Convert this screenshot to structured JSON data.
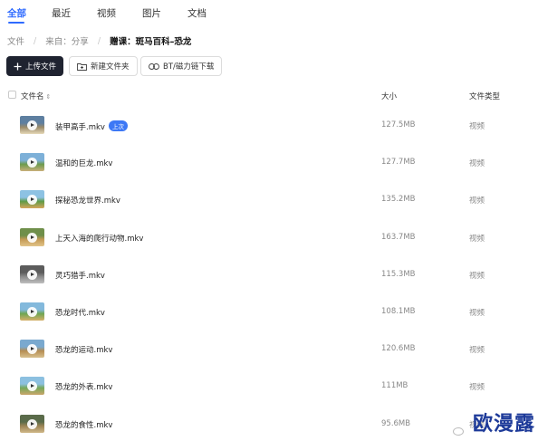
{
  "tabs": [
    {
      "label": "全部"
    },
    {
      "label": "最近"
    },
    {
      "label": "视频"
    },
    {
      "label": "图片"
    },
    {
      "label": "文档"
    }
  ],
  "breadcrumb": {
    "root": "文件",
    "from": "来自：分享",
    "current": "赠课：斑马百科–恐龙"
  },
  "toolbar": {
    "upload_label": "上传文件",
    "new_folder_label": "新建文件夹",
    "bt_label": "BT/磁力链下载"
  },
  "table": {
    "headers": {
      "name": "文件名",
      "size": "大小",
      "type": "文件类型"
    },
    "rows": [
      {
        "name": "装甲高手.mkv",
        "badge": "上次",
        "size": "127.5MB",
        "type": "视频",
        "thumb_colors": [
          "#5e7fa0",
          "#9a8a6a",
          "#e6d9b8"
        ]
      },
      {
        "name": "温和的巨龙.mkv",
        "size": "127.7MB",
        "type": "视频",
        "thumb_colors": [
          "#7db0d8",
          "#6d9b4e",
          "#c9b07a"
        ]
      },
      {
        "name": "探秘恐龙世界.mkv",
        "size": "135.2MB",
        "type": "视频",
        "thumb_colors": [
          "#8dc2e3",
          "#5f9b46",
          "#d6a65b"
        ]
      },
      {
        "name": "上天入海的爬行动物.mkv",
        "size": "163.7MB",
        "type": "视频",
        "thumb_colors": [
          "#6f8f4a",
          "#c49a55",
          "#e2c48a"
        ]
      },
      {
        "name": "灵巧猎手.mkv",
        "size": "115.3MB",
        "type": "视频",
        "thumb_colors": [
          "#5c5c5c",
          "#8a8a8a",
          "#bfbfbf"
        ]
      },
      {
        "name": "恐龙时代.mkv",
        "size": "108.1MB",
        "type": "视频",
        "thumb_colors": [
          "#83b9dc",
          "#6fa552",
          "#d7b06a"
        ]
      },
      {
        "name": "恐龙的运动.mkv",
        "size": "120.6MB",
        "type": "视频",
        "thumb_colors": [
          "#7aa9cf",
          "#b58d52",
          "#d8c08e"
        ]
      },
      {
        "name": "恐龙的外表.mkv",
        "size": "111MB",
        "type": "视频",
        "thumb_colors": [
          "#8cc0e0",
          "#77a85a",
          "#caa66a"
        ]
      },
      {
        "name": "恐龙的食性.mkv",
        "size": "95.6MB",
        "type": "视频",
        "thumb_colors": [
          "#5a6b4a",
          "#9b8455",
          "#d1b98a"
        ]
      }
    ]
  },
  "watermark": {
    "text": "欧漫露"
  },
  "colors": {
    "accent": "#2f6bff",
    "badge": "#3d78f5",
    "upload_bg": "#1f2330"
  }
}
